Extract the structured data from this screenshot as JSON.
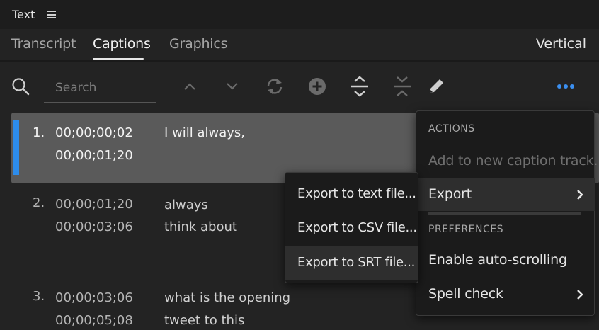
{
  "panel": {
    "title": "Text"
  },
  "tabs": [
    {
      "label": "Transcript"
    },
    {
      "label": "Captions"
    },
    {
      "label": "Graphics"
    }
  ],
  "active_tab": "Captions",
  "view_mode": "Vertical",
  "search": {
    "placeholder": "Search",
    "value": ""
  },
  "toolbar_icons": [
    "chevron-up-icon",
    "chevron-down-icon",
    "refresh-icon",
    "add-circle-icon",
    "expand-vertical-icon",
    "collapse-vertical-icon",
    "pencil-icon",
    "more-icon"
  ],
  "accent_color": "#2d8ceb",
  "captions": [
    {
      "num": "1.",
      "start": "00;00;00;02",
      "end": "00;00;01;20",
      "text1": "I will always,",
      "text2": "",
      "selected": true
    },
    {
      "num": "2.",
      "start": "00;00;01;20",
      "end": "00;00;03;06",
      "text1": "always",
      "text2": "think about",
      "selected": false
    },
    {
      "num": "3.",
      "start": "00;00;03;06",
      "end": "00;00;05;08",
      "text1": "what is the opening",
      "text2": "tweet to this",
      "selected": false
    }
  ],
  "menu": {
    "actions_header": "ACTIONS",
    "add_track": "Add to new caption track...",
    "export": "Export",
    "preferences_header": "PREFERENCES",
    "auto_scroll": "Enable auto-scrolling",
    "spell_check": "Spell check"
  },
  "export_submenu": {
    "text_file": "Export to text file...",
    "csv_file": "Export to CSV file...",
    "srt_file": "Export to SRT file..."
  }
}
